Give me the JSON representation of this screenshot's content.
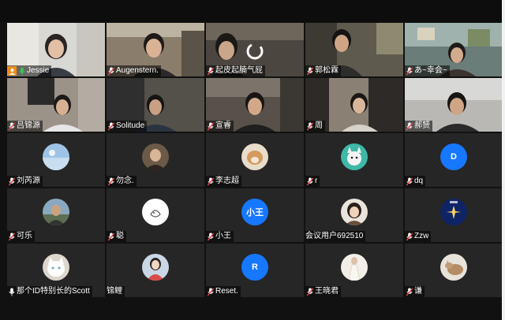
{
  "window": {
    "title": ""
  },
  "colors": {
    "background": "#111111",
    "tile": "#262626",
    "active_border": "#4caf50",
    "muted_mic": "#e5484d",
    "active_mic": "#34c759",
    "host_badge": "#f08c1b",
    "avatar_blue": "#1677ff"
  },
  "participants": [
    {
      "name": "Jessie",
      "mic": "active",
      "host": true,
      "video": true,
      "active": true
    },
    {
      "name": "Augenstern.",
      "mic": "muted",
      "video": true
    },
    {
      "name": "起皮起腩气屁",
      "mic": "muted",
      "video": true
    },
    {
      "name": "郭松霖",
      "mic": "muted",
      "video": true
    },
    {
      "name": "あ~幸会~",
      "mic": "muted",
      "video": true
    },
    {
      "name": "吕锦源",
      "mic": "muted",
      "video": true
    },
    {
      "name": "Solitude",
      "mic": "muted",
      "video": true
    },
    {
      "name": "宣睿",
      "mic": "muted",
      "video": true
    },
    {
      "name": "周",
      "mic": "muted",
      "video": true
    },
    {
      "name": "郝赟",
      "mic": "muted",
      "video": true
    },
    {
      "name": "刘芮源",
      "mic": "muted",
      "video": false,
      "avatar": "sky-photo"
    },
    {
      "name": "勿念.",
      "mic": "muted",
      "video": false,
      "avatar": "person-photo"
    },
    {
      "name": "李志超",
      "mic": "muted",
      "video": false,
      "avatar": "dog-photo"
    },
    {
      "name": "r",
      "mic": "muted",
      "video": false,
      "avatar": "cartoon-cat"
    },
    {
      "name": "dq",
      "mic": "muted",
      "video": false,
      "avatar_text": "D"
    },
    {
      "name": "可乐",
      "mic": "muted",
      "video": false,
      "avatar": "outdoor-photo"
    },
    {
      "name": "聪",
      "mic": "muted",
      "video": false,
      "avatar": "sketch"
    },
    {
      "name": "小王",
      "mic": "muted",
      "video": false,
      "avatar_text": "小王"
    },
    {
      "name": "会议用户692510",
      "mic": "none",
      "video": false,
      "avatar": "girl-photo"
    },
    {
      "name": "Zzw",
      "mic": "muted",
      "video": false,
      "avatar": "star-logo"
    },
    {
      "name": "那个ID特别长的Scott",
      "mic": "unmuted",
      "video": false,
      "avatar": "white-cat"
    },
    {
      "name": "锦鲤",
      "mic": "none",
      "video": false,
      "avatar": "anime-girl"
    },
    {
      "name": "Reset.",
      "mic": "muted",
      "video": false,
      "avatar_text": "R"
    },
    {
      "name": "王晓君",
      "mic": "muted",
      "video": false,
      "avatar": "dress-photo"
    },
    {
      "name": "谦",
      "mic": "muted",
      "video": false,
      "avatar": "cat-photo"
    }
  ]
}
